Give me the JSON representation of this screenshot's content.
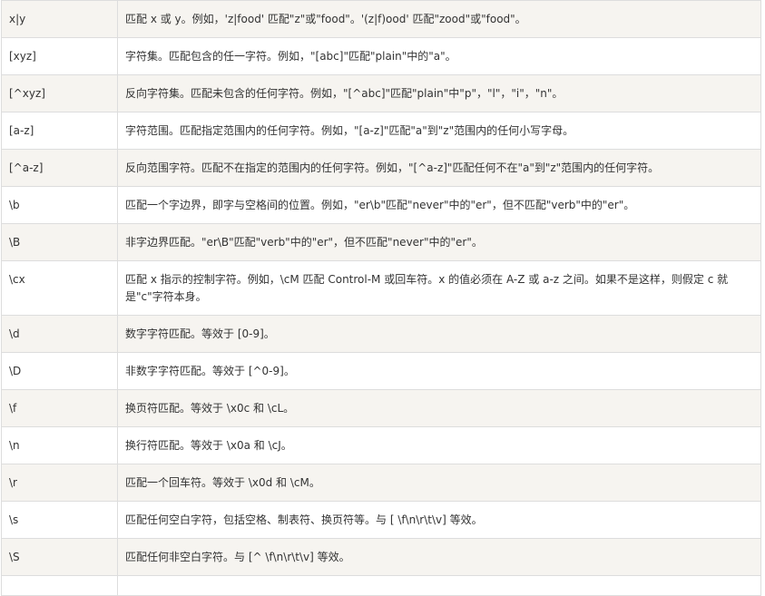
{
  "table": {
    "rows": [
      {
        "syntax": "x|y",
        "description": "匹配 x 或 y。例如，'z|food' 匹配\"z\"或\"food\"。'(z|f)ood' 匹配\"zood\"或\"food\"。"
      },
      {
        "syntax": "[xyz]",
        "description": "字符集。匹配包含的任一字符。例如，\"[abc]\"匹配\"plain\"中的\"a\"。"
      },
      {
        "syntax": "[^xyz]",
        "description": "反向字符集。匹配未包含的任何字符。例如，\"[^abc]\"匹配\"plain\"中\"p\"，\"l\"，\"i\"，\"n\"。"
      },
      {
        "syntax": "[a-z]",
        "description": "字符范围。匹配指定范围内的任何字符。例如，\"[a-z]\"匹配\"a\"到\"z\"范围内的任何小写字母。"
      },
      {
        "syntax": "[^a-z]",
        "description": "反向范围字符。匹配不在指定的范围内的任何字符。例如，\"[^a-z]\"匹配任何不在\"a\"到\"z\"范围内的任何字符。"
      },
      {
        "syntax": "\\b",
        "description": "匹配一个字边界，即字与空格间的位置。例如，\"er\\b\"匹配\"never\"中的\"er\"，但不匹配\"verb\"中的\"er\"。"
      },
      {
        "syntax": "\\B",
        "description": "非字边界匹配。\"er\\B\"匹配\"verb\"中的\"er\"，但不匹配\"never\"中的\"er\"。"
      },
      {
        "syntax": "\\cx",
        "description": "匹配 x 指示的控制字符。例如，\\cM 匹配 Control-M 或回车符。x 的值必须在 A-Z 或 a-z 之间。如果不是这样，则假定 c 就是\"c\"字符本身。"
      },
      {
        "syntax": "\\d",
        "description": "数字字符匹配。等效于 [0-9]。"
      },
      {
        "syntax": "\\D",
        "description": "非数字字符匹配。等效于 [^0-9]。"
      },
      {
        "syntax": "\\f",
        "description": "换页符匹配。等效于 \\x0c 和 \\cL。"
      },
      {
        "syntax": "\\n",
        "description": "换行符匹配。等效于 \\x0a 和 \\cJ。"
      },
      {
        "syntax": "\\r",
        "description": "匹配一个回车符。等效于 \\x0d 和 \\cM。"
      },
      {
        "syntax": "\\s",
        "description": "匹配任何空白字符，包括空格、制表符、换页符等。与 [ \\f\\n\\r\\t\\v] 等效。"
      },
      {
        "syntax": "\\S",
        "description": "匹配任何非空白字符。与 [^ \\f\\n\\r\\t\\v] 等效。"
      },
      {
        "syntax": "",
        "description": ""
      }
    ]
  }
}
